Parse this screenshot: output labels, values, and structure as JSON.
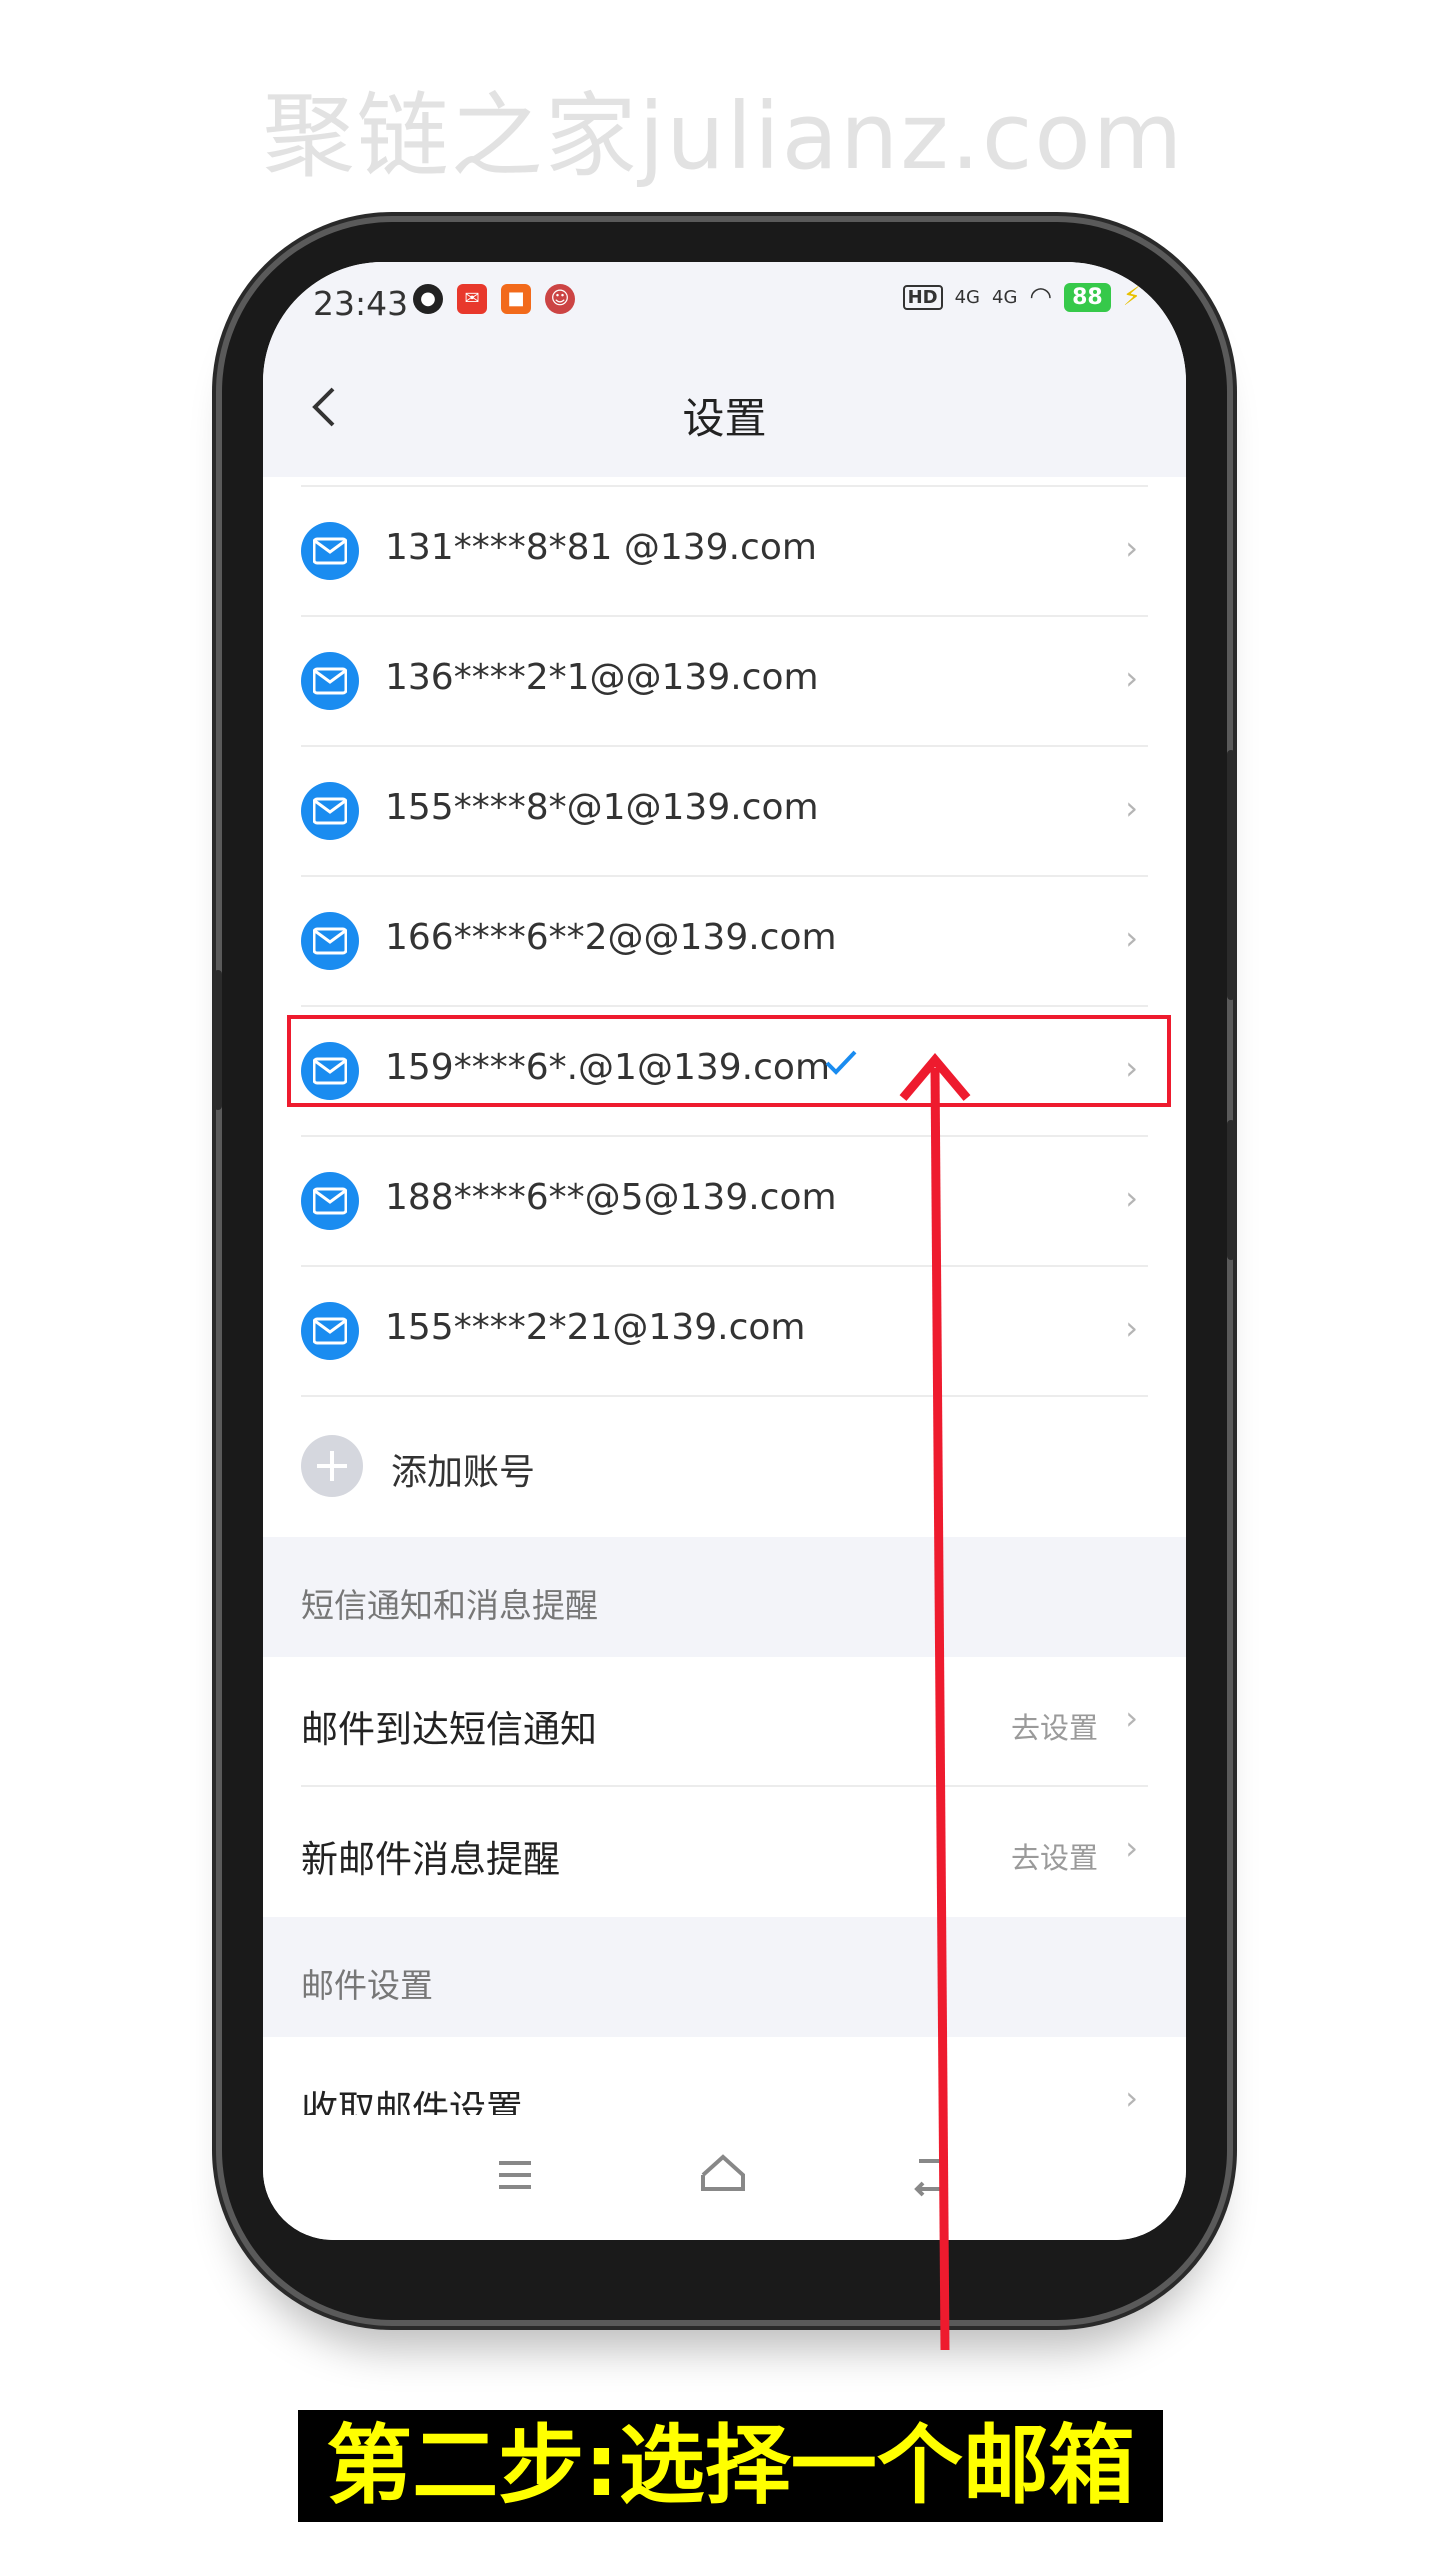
{
  "watermark": "聚链之家julianz.com",
  "status_bar": {
    "time": "23:43",
    "battery": "88",
    "network_labels": [
      "HD",
      "4G",
      "4G"
    ]
  },
  "header": {
    "title": "设置"
  },
  "accounts": [
    {
      "label": "131****8*81 @139.com",
      "selected": false
    },
    {
      "label": "136****2*1@@139.com",
      "selected": false
    },
    {
      "label": "155****8*@1@139.com",
      "selected": false
    },
    {
      "label": "166****6**2@@139.com",
      "selected": false
    },
    {
      "label": "159****6*.@1@139.com",
      "selected": true
    },
    {
      "label": "188****6**@5@139.com",
      "selected": false
    },
    {
      "label": "155****2*21@139.com",
      "selected": false
    }
  ],
  "add_account_label": "添加账号",
  "sections": {
    "sms": {
      "header": "短信通知和消息提醒",
      "items": [
        {
          "label": "邮件到达短信通知",
          "action": "去设置"
        },
        {
          "label": "新邮件消息提醒",
          "action": "去设置"
        }
      ]
    },
    "mail": {
      "header": "邮件设置",
      "items": [
        {
          "label": "收取邮件设置",
          "action": ""
        }
      ]
    }
  },
  "caption": "第二步:选择一个邮箱",
  "colors": {
    "accent": "#1a8cf0",
    "highlight": "#ee1b2e",
    "caption_text": "#ffff00"
  },
  "icons": [
    "back-icon",
    "mail-icon",
    "check-icon",
    "plus-icon",
    "menu-icon",
    "home-icon",
    "return-icon",
    "chevron-right-icon"
  ]
}
